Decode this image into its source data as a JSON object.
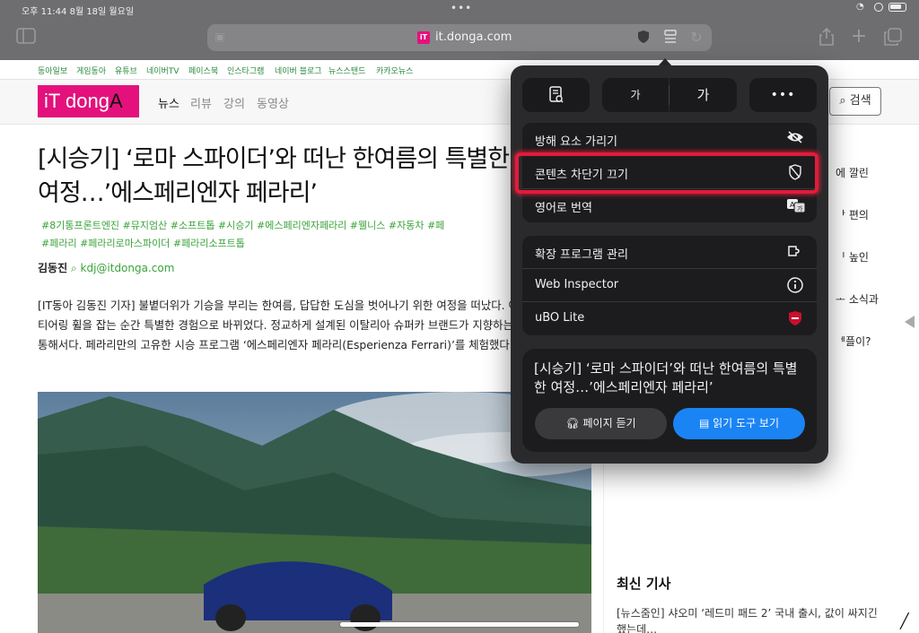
{
  "status": {
    "time": "오후 11:44  8월 18일 월요일"
  },
  "browser": {
    "url": "it.donga.com",
    "favicon_text": "iT"
  },
  "topnav": [
    "동아일보",
    "게임동아",
    "유튜브",
    "네이버TV",
    "페이스북",
    "인스타그램",
    "네이버 블로그",
    "뉴스스탠드",
    "카카오뉴스"
  ],
  "site": {
    "logo_main": "iT dong",
    "logo_accent": "A",
    "menu": [
      "뉴스",
      "리뷰",
      "강의",
      "동영상"
    ],
    "search_label": "검색"
  },
  "article": {
    "headline": "[시승기] ‘로마 스파이더’와 떠난 한여름의 특별한 여정…’에스페리엔자 페라리’",
    "tags_line1": "#8기통프론트엔진   #뮤지엄산   #소프트톱   #시승기   #에스페리엔자페라리   #웰니스   #자동차   #페",
    "tags_line2": "#페라리   #페라리로마스파이더   #페라리소프트톱",
    "author": "김동진",
    "email": "kdj@itdonga.com",
    "body": "[IT동아 김동진 기자] 불볕더위가 기승을 부리는 한여름, 답답한 도심을 벗어나기 위한 여정을 떠났다. 여정은 페라리 스티어링 휠을 잡는 순간 특별한 경험으로 바뀌었다. 정교하게 설계된 이탈리아 슈퍼카 브랜드가 지향하는 라이프스타일을 통해서다. 페라리만의 고유한 시승 프로그램 ‘에스페리엔자 페라리(Esperienza Ferrari)’를 체험했다."
  },
  "sidebar": {
    "snippets": [
      "에 깔린",
      "ᅡ 편의",
      "ᅵ 높인",
      "ᅩ 소식과",
      "ᅦ플이?"
    ],
    "latest_title": "최신 기사",
    "latest_item": "[뉴스줌인] 샤오미 ‘레드미 패드 2’ 국내 출시, 값이 싸지긴 했는데…"
  },
  "popup": {
    "top_buttons": [
      "가",
      "가",
      "•••"
    ],
    "group1": [
      {
        "label": "방해 요소 가리기",
        "icon": "eye-slash-icon"
      },
      {
        "label": "콘텐츠 차단기 끄기",
        "icon": "shield-slash-icon"
      },
      {
        "label": "영어로 번역",
        "icon": "translate-icon"
      }
    ],
    "group2": [
      {
        "label": "확장 프로그램 관리",
        "icon": "extension-icon"
      },
      {
        "label": "Web Inspector",
        "icon": "info-icon"
      },
      {
        "label": "uBO Lite",
        "icon": "ubo-shield-icon"
      }
    ],
    "reader_title": "[시승기] ‘로마 스파이더’와 떠난 한여름의 특별한 여정…’에스페리엔자 페라리’",
    "listen_label": "페이지 듣기",
    "reader_label": "읽기 도구 보기"
  },
  "colors": {
    "highlight": "#e01c3c",
    "accent_blue": "#1a84f5",
    "brand_pink": "#e4117c",
    "tag_green": "#3aa33a"
  }
}
